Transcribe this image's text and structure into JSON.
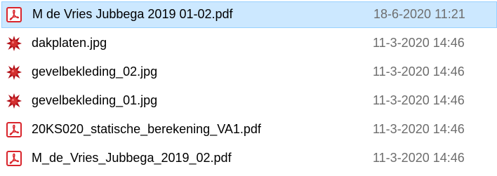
{
  "files": [
    {
      "name": "M de Vries Jubbega 2019 01-02.pdf",
      "modified": "18-6-2020 11:21",
      "icon": "pdf-icon",
      "selected": true
    },
    {
      "name": "dakplaten.jpg",
      "modified": "11-3-2020 14:46",
      "icon": "jpg-image-icon",
      "selected": false
    },
    {
      "name": "gevelbekleding_02.jpg",
      "modified": "11-3-2020 14:46",
      "icon": "jpg-image-icon",
      "selected": false
    },
    {
      "name": "gevelbekleding_01.jpg",
      "modified": "11-3-2020 14:46",
      "icon": "jpg-image-icon",
      "selected": false
    },
    {
      "name": "20KS020_statische_berekening_VA1.pdf",
      "modified": "11-3-2020 14:46",
      "icon": "pdf-icon",
      "selected": false
    },
    {
      "name": "M_de_Vries_Jubbega_2019_02.pdf",
      "modified": "11-3-2020 14:46",
      "icon": "pdf-icon",
      "selected": false
    }
  ],
  "colors": {
    "selection_fill": "#cce8ff",
    "selection_border": "#99d1ff",
    "pdf_red": "#d9252c",
    "jpg_red": "#b3121a",
    "date_text": "#6d6d6d"
  }
}
